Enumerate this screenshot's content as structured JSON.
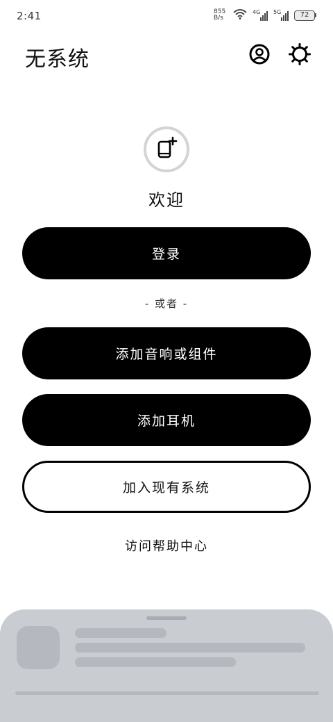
{
  "status_bar": {
    "time": "2:41",
    "net_speed_value": "855",
    "net_speed_unit": "B/s",
    "signal_1_label": "4G",
    "signal_2_label": "5G",
    "battery_level": "72",
    "icons": [
      "wifi-icon",
      "signal-4g-icon",
      "signal-5g-icon",
      "battery-icon"
    ]
  },
  "header": {
    "title": "无系统",
    "icons": [
      "account-circle-icon",
      "settings-gear-icon"
    ]
  },
  "hero": {
    "icon": "add-device-icon",
    "welcome": "欢迎"
  },
  "actions": {
    "login_label": "登录",
    "or_label": "- 或者 -",
    "add_speaker_label": "添加音响或组件",
    "add_headphones_label": "添加耳机",
    "join_system_label": "加入现有系统",
    "help_label": "访问帮助中心"
  },
  "colors": {
    "primary": "#000000",
    "background": "#ffffff",
    "sheet": "#c9ccd1",
    "skeleton": "#b5b9bf"
  }
}
